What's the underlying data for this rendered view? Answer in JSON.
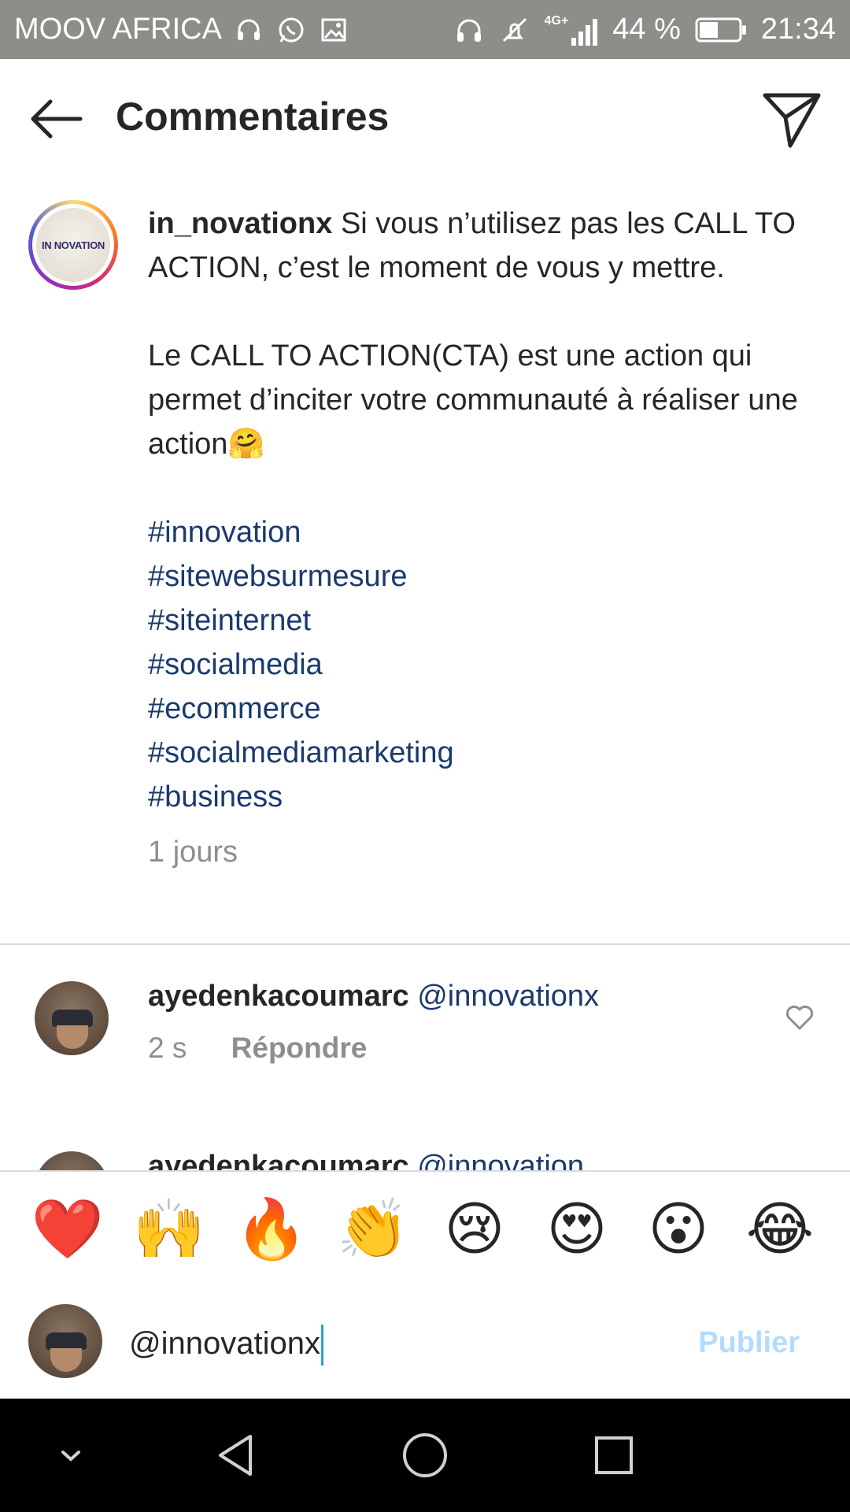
{
  "status_bar": {
    "carrier": "MOOV AFRICA",
    "network": "4G+",
    "battery": "44 %",
    "time": "21:34",
    "icons": [
      "headset-icon",
      "whatsapp-icon",
      "gallery-icon",
      "headphones-icon",
      "mute-icon",
      "signal-icon",
      "battery-icon"
    ]
  },
  "header": {
    "title": "Commentaires",
    "back_icon": "back-arrow-icon",
    "send_icon": "send-icon"
  },
  "caption": {
    "username": "in_novationx",
    "avatar_text": "IN NOVATION",
    "line1": "Si vous n’utilisez pas les CALL TO ACTION, c’est le moment de vous y mettre.",
    "line2": "Le CALL TO ACTION(CTA) est une action qui permet d’inciter votre communauté à réaliser une action",
    "emoji": "🤗",
    "hashtags": [
      "#innovation",
      "#sitewebsurmesure",
      "#siteinternet",
      "#socialmedia",
      "#ecommerce",
      "#socialmediamarketing",
      "#business"
    ],
    "age": "1 jours"
  },
  "comments": [
    {
      "username": "ayedenkacoumarc",
      "mention": "@innovationx",
      "time": "2 s",
      "reply_label": "Répondre"
    },
    {
      "username": "ayedenkacoumarc",
      "mention": "@innovation"
    }
  ],
  "emoji_bar": [
    "❤️",
    "🙌",
    "🔥",
    "👏",
    "😢",
    "😍",
    "😮",
    "😂"
  ],
  "composer": {
    "value": "@innovationx",
    "publish_label": "Publier"
  },
  "colors": {
    "status_bar": "#8e8d8a",
    "hashtag": "#1a3a6e",
    "publish_disabled": "#b3dbff",
    "meta_gray": "#8e8e8e",
    "caret": "#26a6c6"
  }
}
